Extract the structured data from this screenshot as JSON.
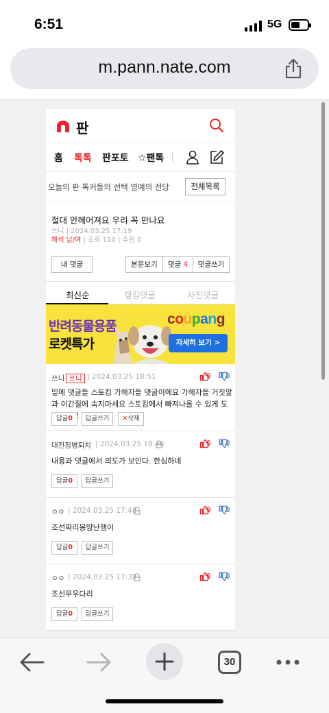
{
  "status_bar": {
    "time": "6:51",
    "network": "5G"
  },
  "browser": {
    "url": "m.pann.nate.com",
    "tab_count": "30"
  },
  "site": {
    "logo_text": "판",
    "nav_tabs": [
      {
        "label": "홈"
      },
      {
        "label": "톡톡"
      },
      {
        "label": "판포토"
      },
      {
        "label": "☆팬톡"
      }
    ],
    "hall_text": "오늘의 판  톡커들의 선택  명예의 전당",
    "all_list_button": "전체목록"
  },
  "post": {
    "title": "절대 안헤어져요 우리 꼭 만나요",
    "author": "쓰니",
    "date": "2024.03.25 17:19",
    "author_tag": "해석 남/여",
    "views": "조회 110",
    "recommend": "추천 0",
    "my_comments_button": "내 댓글",
    "view_body_button": "본문보기",
    "comments_button_label": "댓글",
    "comments_count": "4",
    "write_comment_button": "댓글쓰기"
  },
  "sort_tabs": [
    "최신순",
    "랭킹댓글",
    "사진댓글"
  ],
  "ad": {
    "line1": "반려동물용품",
    "line2": "로켓특가",
    "brand": "coupang",
    "cta": "자세히 보기 >",
    "brand_colors": [
      "#8b2b2b",
      "#e8262b",
      "#f5a623",
      "#3aa83a",
      "#1e6fe0",
      "#1e9ee0",
      "#8b2b2b"
    ]
  },
  "comments": [
    {
      "author": "쓰니",
      "badge": "쓰니",
      "date": "2024.03.25 18:51",
      "likes": "0",
      "dislikes": "0",
      "body": "밑에 댓글들 스토킹 가해자들 댓글이에요 가해자들 거짓말과 이간질에 속지마세요 스토킹에서 빠져나올 수 있게 도와주세요",
      "reply_label": "답글",
      "reply_count": "0",
      "write_reply": "답글쓰기",
      "delete": "삭제"
    },
    {
      "author": "대전정병퇴치",
      "date": "2024.03.25 18:46",
      "likes": "0",
      "dislikes": "0",
      "body": "내용과 댓글에서 의도가 보인다. 한심하네",
      "reply_label": "답글",
      "reply_count": "0",
      "write_reply": "답글쓰기"
    },
    {
      "author": "ㅇㅇ",
      "date": "2024.03.25 17:48",
      "likes": "0",
      "dislikes": "0",
      "body": "조선짜리몽땅난쟁이",
      "reply_label": "답글",
      "reply_count": "0",
      "write_reply": "답글쓰기"
    },
    {
      "author": "ㅇㅇ",
      "date": "2024.03.25 17:38",
      "likes": "0",
      "dislikes": "0",
      "body": "조선무우다리",
      "reply_label": "답글",
      "reply_count": "0",
      "write_reply": "답글쓰기"
    }
  ],
  "colors": {
    "accent": "#e8262b",
    "ad_bg": "#f8e33c",
    "ad_purple": "#6a2ec0",
    "cta_blue": "#1e6fe0"
  }
}
